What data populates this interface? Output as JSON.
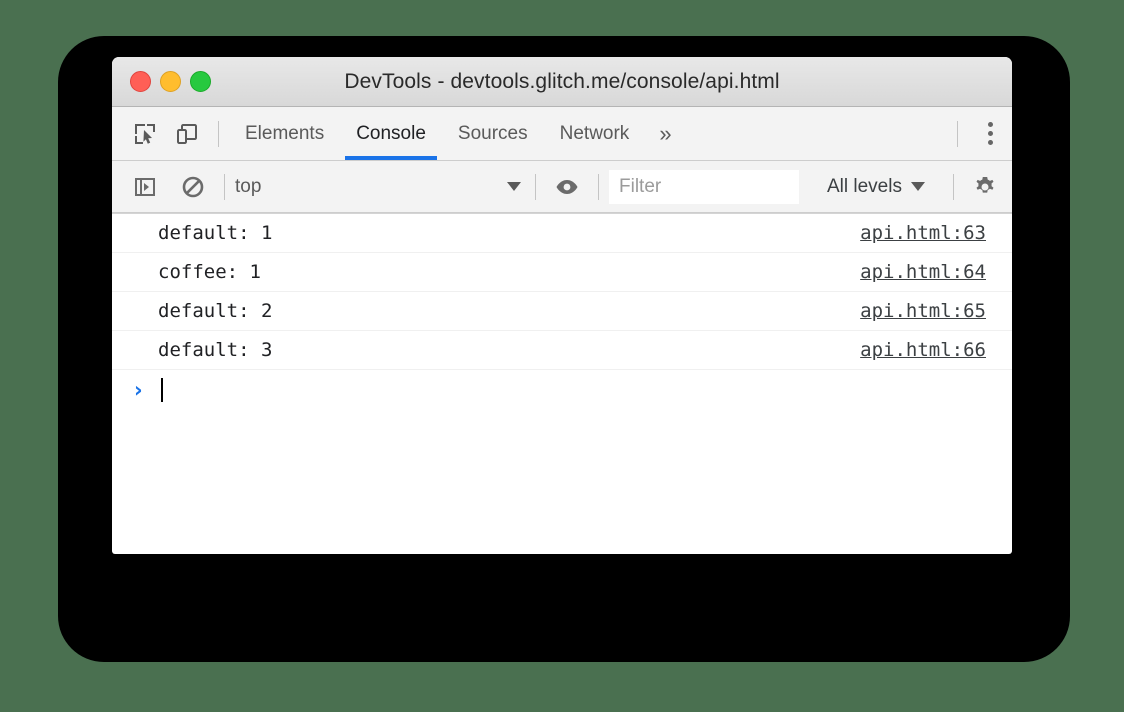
{
  "window": {
    "title": "DevTools - devtools.glitch.me/console/api.html",
    "traffic_lights": [
      {
        "name": "close",
        "color": "#ff5f56"
      },
      {
        "name": "minimize",
        "color": "#ffbd2e"
      },
      {
        "name": "zoom",
        "color": "#27c93f"
      }
    ]
  },
  "toolbar": {
    "inspect_icon": "inspect-element-icon",
    "device_icon": "device-toolbar-icon",
    "overflow_label": "»",
    "more_label": "more-options-icon",
    "tabs": [
      {
        "label": "Elements",
        "active": false
      },
      {
        "label": "Console",
        "active": true
      },
      {
        "label": "Sources",
        "active": false
      },
      {
        "label": "Network",
        "active": false
      }
    ],
    "accent_color": "#1a73e8"
  },
  "filterbar": {
    "sidebar_icon": "console-sidebar-icon",
    "clear_icon": "clear-console-icon",
    "context": "top",
    "eye_icon": "live-expression-eye-icon",
    "filter_placeholder": "Filter",
    "filter_value": "",
    "levels": "All levels",
    "settings_icon": "settings-gear-icon"
  },
  "console": {
    "messages": [
      {
        "text": "default: 1",
        "source": "api.html:63"
      },
      {
        "text": "coffee: 1",
        "source": "api.html:64"
      },
      {
        "text": "default: 2",
        "source": "api.html:65"
      },
      {
        "text": "default: 3",
        "source": "api.html:66"
      }
    ],
    "prompt_symbol": "›",
    "prompt_value": ""
  }
}
